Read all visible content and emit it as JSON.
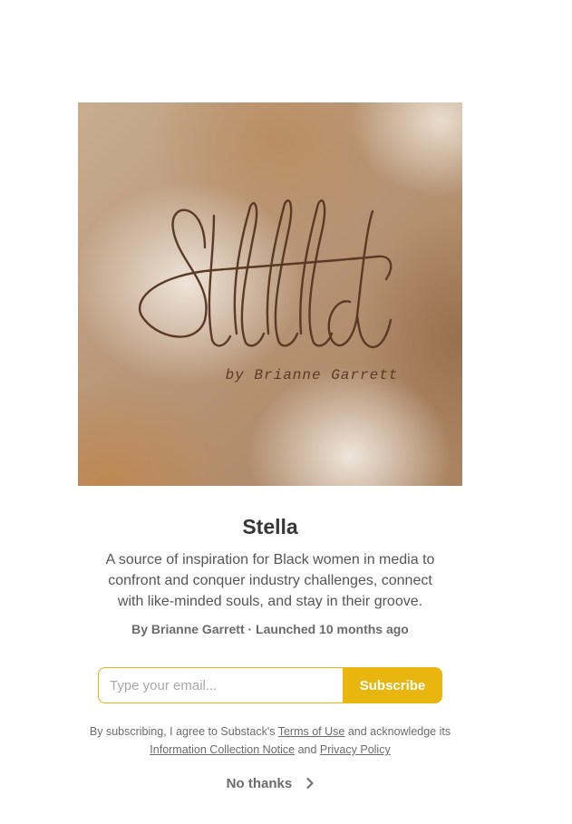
{
  "cover": {
    "logo_text": "Stella",
    "byline": "by Brianne Garrett"
  },
  "publication": {
    "title": "Stella",
    "description": "A source of inspiration for Black women in media to confront and conquer industry challenges, connect with like-minded souls, and stay in their groove.",
    "meta": "By Brianne Garrett · Launched 10 months ago"
  },
  "subscribe_form": {
    "email_placeholder": "Type your email...",
    "email_value": "",
    "button_label": "Subscribe"
  },
  "legal": {
    "prefix": "By subscribing, I agree to Substack's ",
    "terms_link": "Terms of Use",
    "middle": " and acknowledge its ",
    "notice_link": "Information Collection Notice",
    "and": " and ",
    "privacy_link": "Privacy Policy"
  },
  "dismiss": {
    "label": "No thanks",
    "icon": "chevron-right-icon"
  },
  "colors": {
    "accent": "#e8b60e",
    "logo_ink": "#5a3a24",
    "title": "#363737",
    "text": "#555555"
  }
}
